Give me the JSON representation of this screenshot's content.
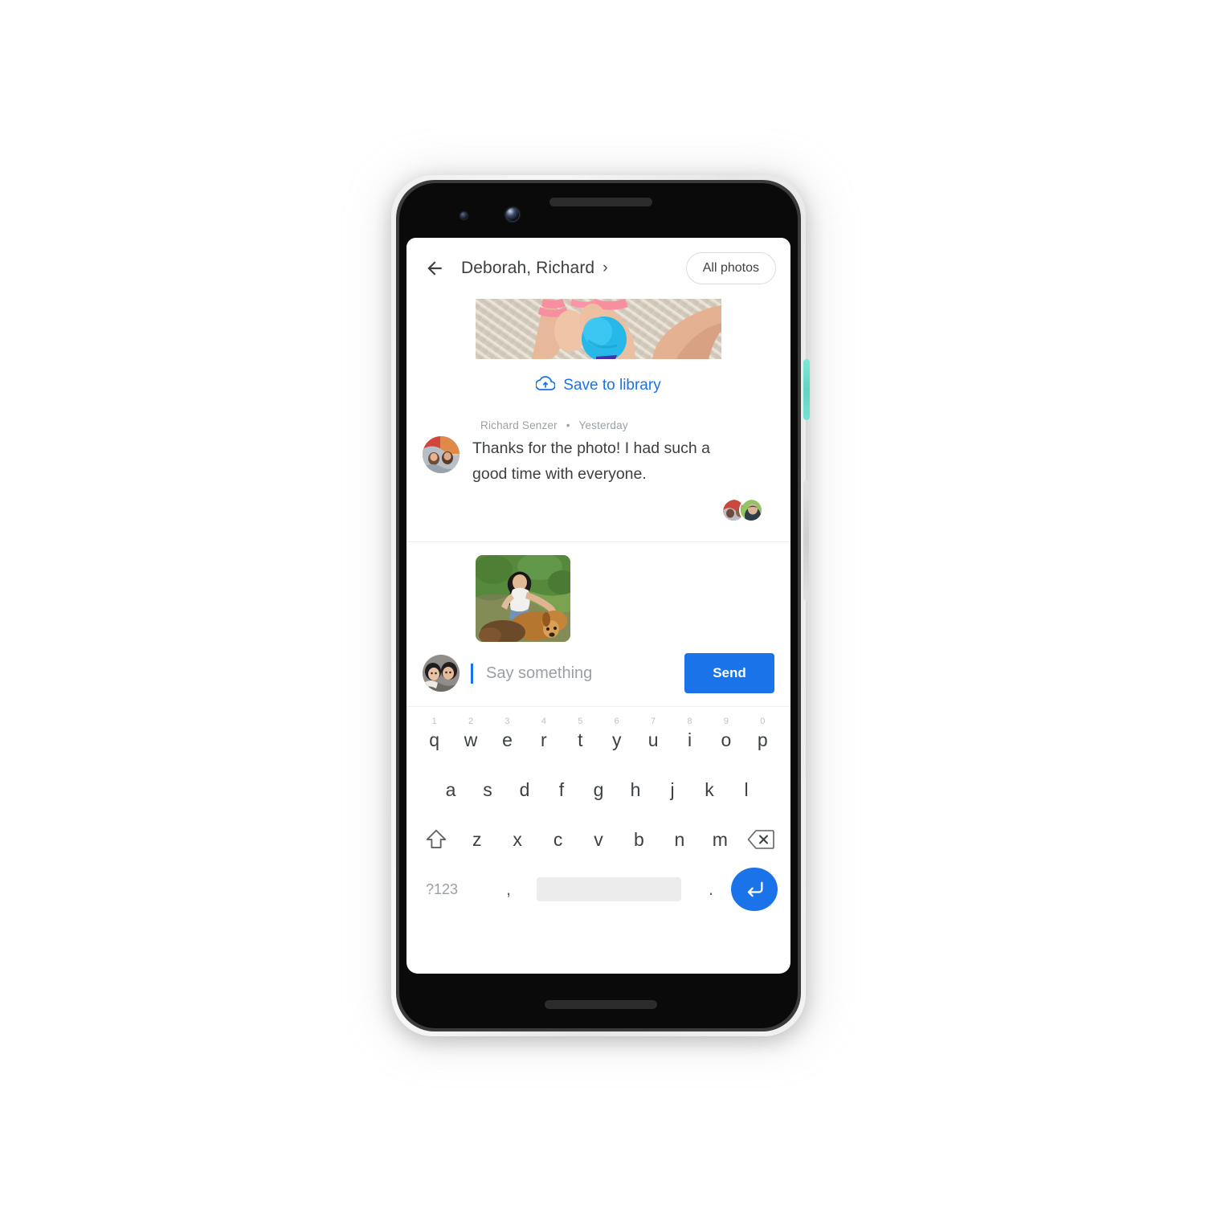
{
  "device": {
    "type": "smartphone",
    "body_color": "#f2f2f2",
    "power_button_color": "#6ee0cf",
    "volume_button_color": "#d8d8d8"
  },
  "app": {
    "accent_color": "#1a73e8",
    "text_color": "#3c4043",
    "muted_color": "#9aa0a6"
  },
  "header": {
    "back_icon": "arrow-left-icon",
    "title": "Deborah, Richard",
    "chevron": "›",
    "all_photos_label": "All photos"
  },
  "thread": {
    "shared_photo": {
      "alt": "child in pink holding a blue ball on a beige rug",
      "save_icon": "cloud-upload-icon",
      "save_label": "Save to library"
    },
    "message": {
      "author": "Richard Senzer",
      "separator": "•",
      "timestamp": "Yesterday",
      "body": "Thanks for the photo! I had such a good time with everyone.",
      "avatar_alt": "photo avatar of Richard Senzer",
      "reactions": [
        {
          "name": "reaction-avatar-1",
          "alt": "red toned photo avatar"
        },
        {
          "name": "reaction-avatar-2",
          "alt": "green toned photo avatar"
        }
      ]
    }
  },
  "composer": {
    "attachment_alt": "woman with a golden retriever outdoors",
    "avatar_alt": "photo avatar of current user",
    "placeholder": "Say something",
    "value": "",
    "send_label": "Send"
  },
  "keyboard": {
    "row1": [
      {
        "key": "q",
        "num": "1"
      },
      {
        "key": "w",
        "num": "2"
      },
      {
        "key": "e",
        "num": "3"
      },
      {
        "key": "r",
        "num": "4"
      },
      {
        "key": "t",
        "num": "5"
      },
      {
        "key": "y",
        "num": "6"
      },
      {
        "key": "u",
        "num": "7"
      },
      {
        "key": "i",
        "num": "8"
      },
      {
        "key": "o",
        "num": "9"
      },
      {
        "key": "p",
        "num": "0"
      }
    ],
    "row2": [
      "a",
      "s",
      "d",
      "f",
      "g",
      "h",
      "j",
      "k",
      "l"
    ],
    "row3": [
      "z",
      "x",
      "c",
      "v",
      "b",
      "n",
      "m"
    ],
    "shift_icon": "shift-arrow-icon",
    "backspace_icon": "backspace-icon",
    "symbols_label": "?123",
    "comma_label": ",",
    "space_label": "",
    "period_label": ".",
    "enter_icon": "enter-return-icon"
  }
}
